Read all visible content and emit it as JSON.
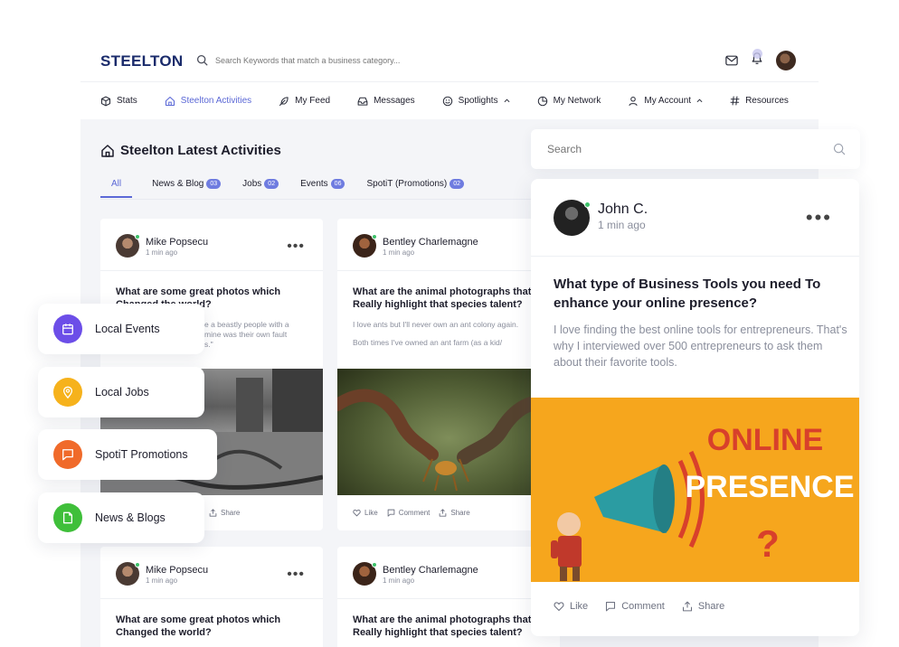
{
  "brand": {
    "logo": "STEELTON"
  },
  "search": {
    "placeholder": "Search Keywords that match a business category..."
  },
  "nav": [
    {
      "label": "Stats"
    },
    {
      "label": "Steelton Activities",
      "active": true
    },
    {
      "label": "My Feed"
    },
    {
      "label": "Messages"
    },
    {
      "label": "Spotlights"
    },
    {
      "label": "My Network"
    },
    {
      "label": "My Account"
    },
    {
      "label": "Resources"
    }
  ],
  "feed": {
    "title": "Steelton Latest Activities",
    "tabs": [
      {
        "label": "All",
        "count": ""
      },
      {
        "label": "News & Blog",
        "count": "03"
      },
      {
        "label": "Jobs",
        "count": "02"
      },
      {
        "label": "Events",
        "count": "06"
      },
      {
        "label": "SpotiT (Promotions)",
        "count": "02"
      }
    ],
    "cards": [
      {
        "name": "Mike Popsecu",
        "time": "1 min ago",
        "question": "What are some great photos which Changed the world?",
        "body1": "e a beastly people with a",
        "body2": "mine was their own fault",
        "body3": "s.\"",
        "actions": {
          "share": "Share"
        }
      },
      {
        "name": "Bentley Charlemagne",
        "time": "1 min ago",
        "question": "What are the animal photographs that Really highlight that species talent?",
        "body1": "I love ants but I'll never own an ant colony again.",
        "body2": "Both times I've owned an ant farm (as a kid/",
        "actions": {
          "like": "Like",
          "comment": "Comment",
          "share": "Share"
        }
      },
      {
        "name": "Mike Popsecu",
        "time": "1 min ago",
        "question": "What are some great photos which Changed the world?"
      },
      {
        "name": "Bentley Charlemagne",
        "time": "1 min ago",
        "question": "What are the animal photographs that Really highlight that species talent?"
      }
    ]
  },
  "shortcuts": [
    {
      "label": "Local Events",
      "color": "#6c4ee8"
    },
    {
      "label": "Local Jobs",
      "color": "#f6b21c"
    },
    {
      "label": "SpotiT Promotions",
      "color": "#f06a2a"
    },
    {
      "label": "News & Blogs",
      "color": "#3fbf3a"
    }
  ],
  "sidebar": {
    "search_placeholder": "Search",
    "post": {
      "name": "John C.",
      "time": "1 min ago",
      "question": "What type of Business Tools you need To enhance your online presence?",
      "body": "I love finding the best online tools for entrepreneurs. That's why I interviewed over 500 entrepreneurs to ask them about their favorite tools.",
      "image_text_line1": "ONLINE",
      "image_text_line2": "PRESENCE",
      "image_text_mark": "?",
      "actions": {
        "like": "Like",
        "comment": "Comment",
        "share": "Share"
      }
    }
  }
}
